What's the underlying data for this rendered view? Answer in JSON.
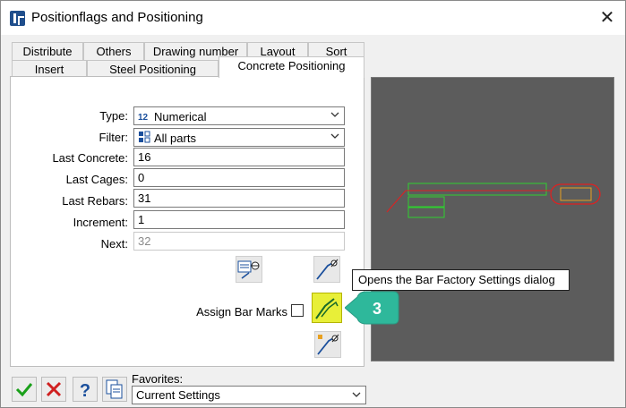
{
  "window": {
    "title": "Positionflags and Positioning",
    "close_symbol": "✕"
  },
  "tabs": {
    "row1": [
      "Distribute",
      "Others",
      "Drawing number",
      "Layout",
      "Sort"
    ],
    "row2": [
      "Insert",
      "Steel Positioning",
      "Concrete Positioning"
    ],
    "active": "Concrete Positioning"
  },
  "form": {
    "type_label": "Type:",
    "type_value": "Numerical",
    "type_icon_text": "12",
    "filter_label": "Filter:",
    "filter_value": "All parts",
    "last_concrete_label": "Last Concrete:",
    "last_concrete_value": "16",
    "last_cages_label": "Last Cages:",
    "last_cages_value": "0",
    "last_rebars_label": "Last Rebars:",
    "last_rebars_value": "31",
    "increment_label": "Increment:",
    "increment_value": "1",
    "next_label": "Next:",
    "next_value": "32",
    "assign_bar_marks_label": "Assign Bar Marks",
    "assign_bar_marks_checked": false
  },
  "tooltip": {
    "text": "Opens the Bar Factory Settings dialog"
  },
  "callout": {
    "number": "3",
    "color": "#2eb89b"
  },
  "footer": {
    "favorites_label": "Favorites:",
    "favorites_value": "Current Settings"
  },
  "icons": {
    "ok": "ok-checkmark-icon",
    "cancel": "cancel-x-icon",
    "help": "help-question-icon",
    "copy": "copy-settings-icon"
  },
  "colors": {
    "highlight": "#e8ef38",
    "preview_bg": "#5c5c5c",
    "preview_green": "#2fd02f",
    "preview_red": "#e02020",
    "preview_orange": "#e8a020"
  }
}
